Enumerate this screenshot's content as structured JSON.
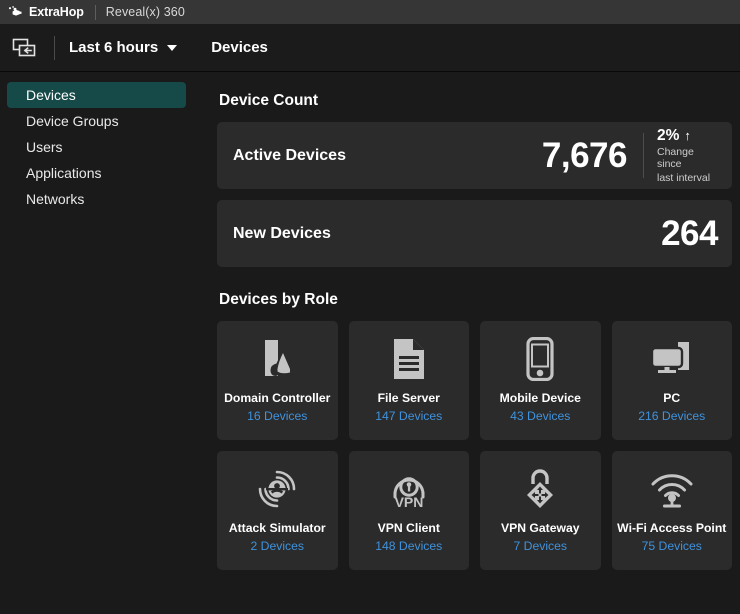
{
  "topbar": {
    "brand": "ExtraHop",
    "brand_logo_icon": "extrahop-logo-icon",
    "product": "Reveal(x) 360"
  },
  "navbar": {
    "panel_toggle_icon": "collapse-panel-left-icon",
    "time_range": "Last 6 hours",
    "caret_icon": "chevron-down-icon",
    "page_title": "Devices"
  },
  "sidebar": {
    "items": [
      {
        "label": "Devices",
        "active": true
      },
      {
        "label": "Device Groups",
        "active": false
      },
      {
        "label": "Users",
        "active": false
      },
      {
        "label": "Applications",
        "active": false
      },
      {
        "label": "Networks",
        "active": false
      }
    ]
  },
  "device_count": {
    "title": "Device Count",
    "cards": [
      {
        "label": "Active Devices",
        "value": "7,676",
        "delta_pct": "2%",
        "delta_arrow": "↑",
        "delta_sub_line1": "Change since",
        "delta_sub_line2": "last interval"
      },
      {
        "label": "New Devices",
        "value": "264"
      }
    ]
  },
  "devices_by_role": {
    "title": "Devices by Role",
    "roles": [
      {
        "name": "Domain Controller",
        "count": "16 Devices",
        "icon": "domain-controller-icon"
      },
      {
        "name": "File Server",
        "count": "147 Devices",
        "icon": "file-server-icon"
      },
      {
        "name": "Mobile Device",
        "count": "43 Devices",
        "icon": "mobile-device-icon"
      },
      {
        "name": "PC",
        "count": "216 Devices",
        "icon": "pc-icon"
      },
      {
        "name": "Attack Simulator",
        "count": "2 Devices",
        "icon": "attack-simulator-icon"
      },
      {
        "name": "VPN Client",
        "count": "148 Devices",
        "icon": "vpn-client-icon"
      },
      {
        "name": "VPN Gateway",
        "count": "7 Devices",
        "icon": "vpn-gateway-icon"
      },
      {
        "name": "Wi-Fi Access Point",
        "count": "75 Devices",
        "icon": "wifi-access-point-icon"
      }
    ]
  },
  "colors": {
    "page_bg": "#1a1a1a",
    "topbar_bg": "#363636",
    "navbar_bg": "#1b1b1b",
    "card_bg": "#2b2b2b",
    "accent_teal": "#164a48",
    "link_blue": "#3f92dd",
    "icon_grey": "#c4c4c4"
  }
}
